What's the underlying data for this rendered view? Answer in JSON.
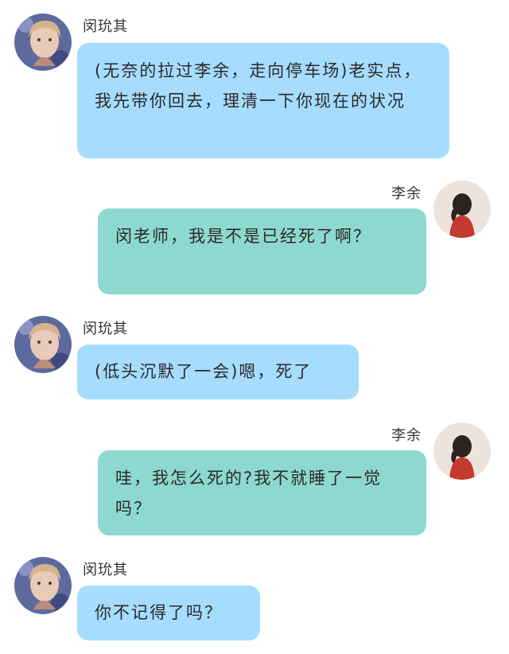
{
  "colors": {
    "left_bubble": "#a6dcff",
    "right_bubble": "#8dd8cf",
    "background": "#ffffff"
  },
  "messages": [
    {
      "side": "left",
      "sender": "闵玧其",
      "avatar_icon": "boy-portrait-avatar",
      "text": "(无奈的拉过李余，走向停车场)老实点，我先带你回去，理清一下你现在的状况"
    },
    {
      "side": "right",
      "sender": "李余",
      "avatar_icon": "girl-back-red-coat-avatar",
      "text": "闵老师，我是不是已经死了啊？"
    },
    {
      "side": "left",
      "sender": "闵玧其",
      "avatar_icon": "boy-portrait-avatar",
      "text": "(低头沉默了一会)嗯，死了"
    },
    {
      "side": "right",
      "sender": "李余",
      "avatar_icon": "girl-back-red-coat-avatar",
      "text": "哇，我怎么死的?我不就睡了一觉吗？"
    },
    {
      "side": "left",
      "sender": "闵玧其",
      "avatar_icon": "boy-portrait-avatar",
      "text": "你不记得了吗？"
    }
  ]
}
